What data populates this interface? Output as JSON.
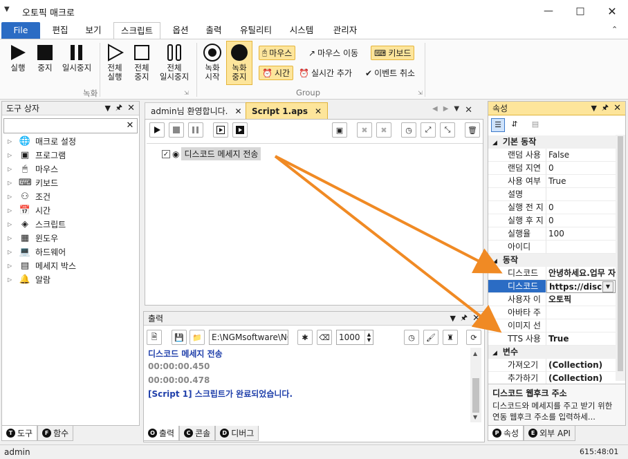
{
  "window": {
    "title": "오토픽 매크로"
  },
  "menu": {
    "file": "File",
    "items": [
      "편집",
      "보기",
      "스크립트",
      "옵션",
      "출력",
      "유틸리티",
      "시스템",
      "관리자"
    ]
  },
  "ribbon": {
    "run": "실행",
    "stop": "중지",
    "pause": "일시중지",
    "run_all": "전체\n실행",
    "stop_all": "전체\n중지",
    "pause_all": "전체\n일시중지",
    "group_record": "녹화",
    "rec_start": "녹화\n시작",
    "rec_stop": "녹화\n중지",
    "mouse": "마우스",
    "mouse_move": "마우스 이동",
    "keyboard": "키보드",
    "time": "시간",
    "realtime_add": "실시간 추가",
    "event_cancel": "이벤트 취소",
    "group_group": "Group"
  },
  "toolbox": {
    "title": "도구 상자",
    "search_value": "",
    "items": [
      "매크로 설정",
      "프로그램",
      "마우스",
      "키보드",
      "조건",
      "시간",
      "스크립트",
      "윈도우",
      "하드웨어",
      "메세지 박스",
      "알람"
    ],
    "tabs": [
      "도구",
      "함수"
    ]
  },
  "documents": {
    "tabs": [
      "admin님 환영합니다.",
      "Script 1.aps"
    ],
    "script_node": "디스코드 메세지 전송"
  },
  "output": {
    "title": "출력",
    "path": "E:\\NGMsoftware\\NG",
    "count": "1000",
    "lines": [
      "디스코드 메세지 전송",
      "00:00:00.450",
      "00:00:00.478",
      "[Script 1] 스크립트가 완료되었습니다."
    ],
    "tabs": [
      "출력",
      "콘솔",
      "디버그"
    ]
  },
  "properties": {
    "title": "속성",
    "cat_basic": "기본 동작",
    "basic": [
      {
        "name": "랜덤 사용",
        "value": "False"
      },
      {
        "name": "랜덤 지연",
        "value": "0"
      },
      {
        "name": "사용 여부",
        "value": "True"
      },
      {
        "name": "설명",
        "value": ""
      },
      {
        "name": "실행 전 지",
        "value": "0"
      },
      {
        "name": "실행 후 지",
        "value": "0"
      },
      {
        "name": "실행율",
        "value": "100"
      },
      {
        "name": "아이디",
        "value": ""
      }
    ],
    "cat_action": "동작",
    "action": [
      {
        "name": "디스코드",
        "value": "안녕하세요.업무 자"
      },
      {
        "name": "디스코드",
        "value": "https://discor"
      },
      {
        "name": "사용자 이",
        "value": "오토픽"
      },
      {
        "name": "아바타 주",
        "value": ""
      },
      {
        "name": "이미지 선",
        "value": ""
      },
      {
        "name": "TTS 사용",
        "value": "True"
      }
    ],
    "cat_vars": "변수",
    "vars": [
      {
        "name": "가져오기",
        "value": "(Collection)"
      },
      {
        "name": "추가하기",
        "value": "(Collection)"
      }
    ],
    "desc_title": "디스코드 웹후크 주소",
    "desc_text": "디스코드와 메세지를 주고 받기 위한 연동 웹후크 주소를 입력하세...",
    "tabs": [
      "속성",
      "외부 API"
    ]
  },
  "status": {
    "user": "admin",
    "coords": "615:48:01"
  }
}
